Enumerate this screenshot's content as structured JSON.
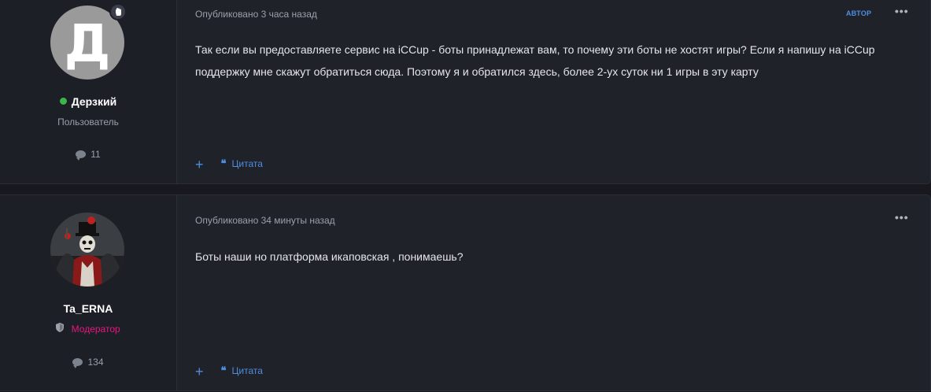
{
  "posts": [
    {
      "author": {
        "avatar_letter": "Д",
        "name": "Дерзкий",
        "online": true,
        "role": "Пользователь",
        "post_count": "11",
        "badge_icon": "hand-icon"
      },
      "meta": "Опубликовано 3 часа назад",
      "author_tag": "АВТОР",
      "more": "•••",
      "content": "Так если вы предоставляете сервис на iCCup - боты принадлежат вам, то почему эти боты не хостят игры? Если я напишу на iCCup поддержку мне скажут обратиться сюда. Поэтому я и обратился здесь, более 2-ух суток ни 1 игры в эту карту",
      "actions": {
        "plus": "+",
        "quote_label": "Цитата",
        "quote_icon": "❝"
      }
    },
    {
      "author": {
        "name": "Ta_ERNA",
        "role": "Модератор",
        "post_count": "134"
      },
      "meta": "Опубликовано 34 минуты назад",
      "more": "•••",
      "content": "Боты наши но платформа икаповская , понимаешь?",
      "actions": {
        "plus": "+",
        "quote_label": "Цитата",
        "quote_icon": "❝"
      }
    }
  ],
  "colors": {
    "accent": "#4f8de0",
    "online": "#3bb54a",
    "moderator": "#e6177f",
    "background": "#17191f",
    "panel": "#1f2229"
  }
}
